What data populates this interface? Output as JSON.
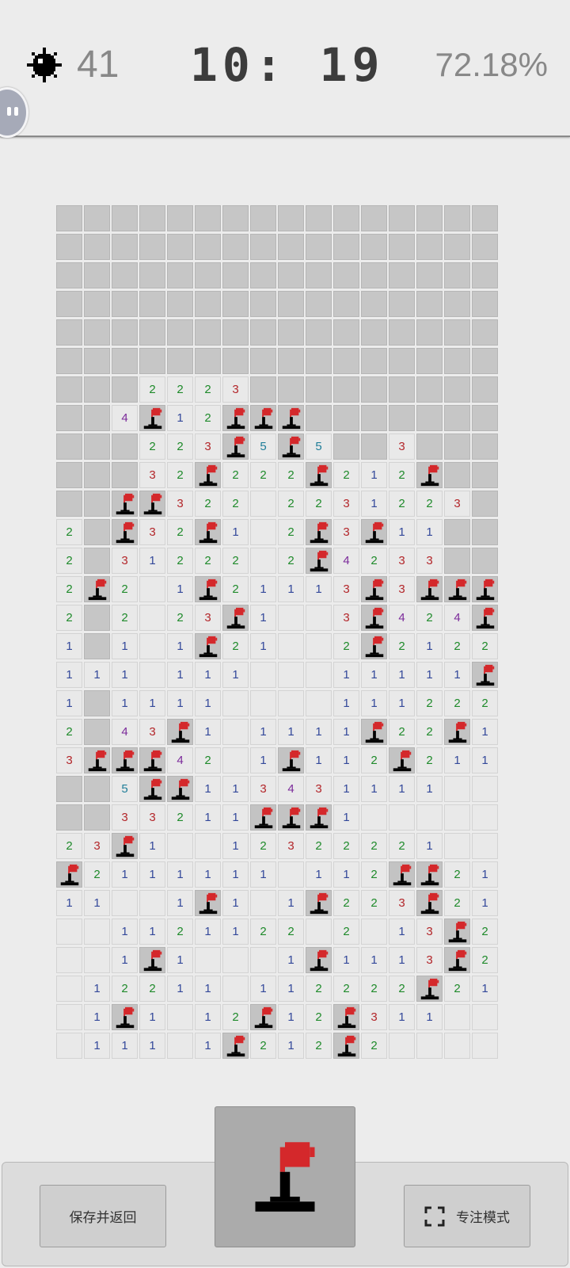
{
  "status": {
    "mines_remaining": "41",
    "timer": "10: 19",
    "progress": "72.18%",
    "icon_mine": "mine-icon"
  },
  "colors": {
    "hidden_cell": "#c6c6c6",
    "open_cell": "#e9e9e9",
    "flag_red": "#d4282b",
    "num1": "#33489a",
    "num2": "#1e8a2a",
    "num3": "#b3262a",
    "num4": "#7b2a9a",
    "num5": "#1f7d98"
  },
  "board": {
    "cols": 16,
    "legend": "H = hidden cell, F = flagged cell, . = opened empty cell, digit = adjacent mine count",
    "rows": [
      "HHHHHHHHHHHHHHHH",
      "HHHHHHHHHHHHHHHH",
      "HHHHHHHHHHHHHHHH",
      "HHHHHHHHHHHHHHHH",
      "HHHHHHHHHHHHHHHH",
      "HHHHHHHHHHHHHHHH",
      "HHH2223HHHHHHHHH",
      "HH4F12FFFHHHHHHH",
      "HHH223F5F5HH3HHH",
      "HHH32F222F212FHH",
      "HHFF322.2231223H",
      "2HF32F1.2F3F11HH",
      "2H31222.2F4233HH",
      "2F2.1F21113F3FFF",
      "2H2.23F1..3F424F",
      "1H1.1F21..2F2122",
      "111.111...11111F1",
      "1H1111....111222",
      "2H43F1.1111F22F1",
      "3FFF42.1F112F211",
      "HH5FF113431111..",
      "HH33211FFF1.....",
      "23F1..12322221..",
      "F2111111.112FF21",
      "11..1F1.1F223F21",
      "..1121122.2.13F2",
      "..1F1...1F1113F2",
      ".12211.112222F211",
      ".1F1.12F12F311..",
      ".111.1F212F2...."
    ]
  },
  "buttons": {
    "save_label": "保存并返回",
    "focus_label": "专注模式",
    "focus_icon": "fullscreen-corners-icon",
    "mode_icon": "flag-icon"
  }
}
